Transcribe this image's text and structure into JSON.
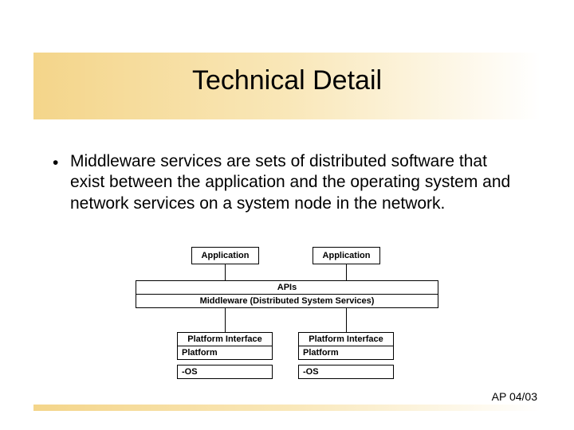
{
  "title": "Technical Detail",
  "bullet": "Middleware services are sets of distributed software that exist between the application and the operating system and network services on a system node in the network.",
  "diagram": {
    "app_left": "Application",
    "app_right": "Application",
    "apis": "APIs",
    "middleware": "Middleware (Distributed System Services)",
    "pif_left": "Platform Interface",
    "pif_right": "Platform Interface",
    "plat_left": "Platform",
    "plat_right": "Platform",
    "os_left": "-OS",
    "os_right": "-OS"
  },
  "footer": "AP 04/03"
}
